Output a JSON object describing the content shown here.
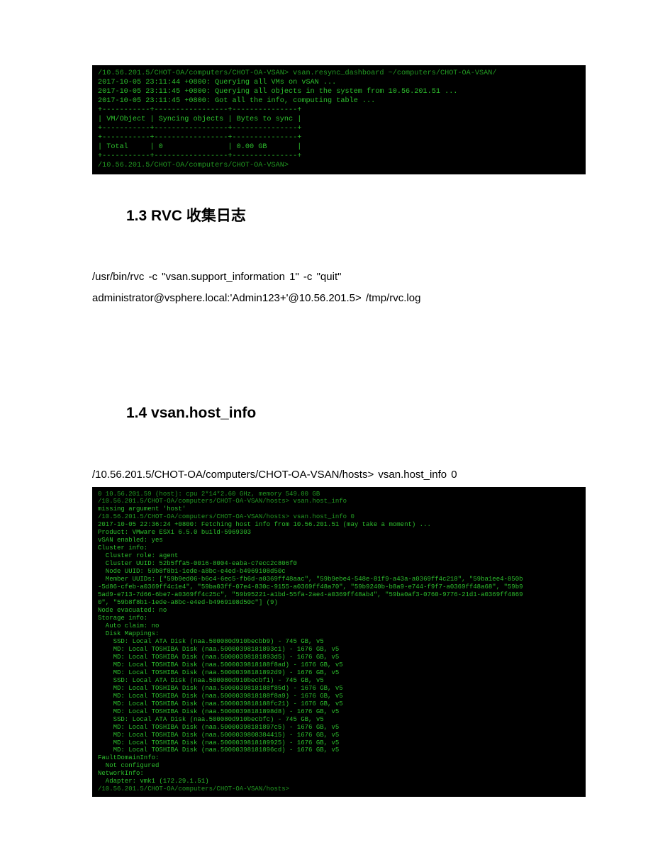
{
  "term1": {
    "l1": "/10.56.201.5/CHOT-OA/computers/CHOT-OA-VSAN> vsan.resync_dashboard ~/computers/CHOT-OA-VSAN/",
    "l2": "2017-10-05 23:11:44 +0800: Querying all VMs on vSAN ...",
    "l3": "2017-10-05 23:11:45 +0800: Querying all objects in the system from 10.56.201.51 ...",
    "l4": "2017-10-05 23:11:45 +0800: Got all the info, computing table ...",
    "sep1": "+-----------+-----------------+---------------+",
    "hdr": "| VM/Object | Syncing objects | Bytes to sync |",
    "sep2": "+-----------+-----------------+---------------+",
    "sep3": "+-----------+-----------------+---------------+",
    "tot": "| Total     | 0               | 0.00 GB       |",
    "sep4": "+-----------+-----------------+---------------+",
    "l5": "/10.56.201.5/CHOT-OA/computers/CHOT-OA-VSAN>"
  },
  "heading13": "1.3 RVC 收集日志",
  "para1_l1": "/usr/bin/rvc  -c  \"vsan.support_information  1\"  -c  \"quit\"",
  "para1_l2": "administrator@vsphere.local:'Admin123+'@10.56.201.5>  /tmp/rvc.log",
  "heading14": "1.4 vsan.host_info",
  "para2_l1": "/10.56.201.5/CHOT-OA/computers/CHOT-OA-VSAN/hosts>  vsan.host_info  0",
  "term2": {
    "l0": "0 10.56.201.59 (host): cpu 2*14*2.60 GHz, memory 549.00 GB",
    "l1": "/10.56.201.5/CHOT-OA/computers/CHOT-OA-VSAN/hosts> vsan.host_info",
    "l2": "missing argument 'host'",
    "l3": "/10.56.201.5/CHOT-OA/computers/CHOT-OA-VSAN/hosts> vsan.host_info 0",
    "l4": "2017-10-05 22:36:24 +0800: Fetching host info from 10.56.201.51 (may take a moment) ...",
    "l5": "Product: VMware ESXi 6.5.0 build-5969303",
    "l6": "vSAN enabled: yes",
    "l7": "Cluster info:",
    "l8": "  Cluster role: agent",
    "l9": "  Cluster UUID: 52b5ffa5-0016-8004-eaba-c7ecc2c806f0",
    "l10": "  Node UUID: 59b8f8b1-1ede-a8bc-e4ed-b4969108d50c",
    "l11": "  Member UUIDs: [\"59b9ed06-b6c4-6ec5-fb6d-a0369ff48aac\", \"59b9ebe4-548e-81f9-a43a-a0369ff4c218\", \"59ba1ee4-850b",
    "l12": "-5d86-cfeb-a0369ff4c1e4\", \"59ba03ff-07e4-830c-9155-a0369ff48a70\", \"59b9240b-b8a9-e744-f9f7-a0369ff48a68\", \"59b9",
    "l13": "5ad9-e713-7d66-6be7-a0369ff4c25c\", \"59b95221-a1bd-55fa-2ae4-a0369ff48ab4\", \"59ba0af3-0760-9776-21d1-a0369ff4869",
    "l14": "0\", \"59b8f8b1-1ede-a8bc-e4ed-b4969108d50c\"] (9)",
    "l15": "Node evacuated: no",
    "l16": "Storage info:",
    "l17": "  Auto claim: no",
    "l18": "  Disk Mappings:",
    "l19": "    SSD: Local ATA Disk (naa.500080d910becbb9) - 745 GB, v5",
    "l20": "    MD: Local TOSHIBA Disk (naa.50000398181893c1) - 1676 GB, v5",
    "l21": "    MD: Local TOSHIBA Disk (naa.50000398181893d5) - 1676 GB, v5",
    "l22": "    MD: Local TOSHIBA Disk (naa.5000039818188f8ad) - 1676 GB, v5",
    "l23": "    MD: Local TOSHIBA Disk (naa.50000398181892d9) - 1676 GB, v5",
    "l24": "    SSD: Local ATA Disk (naa.500080d910becbf1) - 745 GB, v5",
    "l25": "    MD: Local TOSHIBA Disk (naa.5000039818188f85d) - 1676 GB, v5",
    "l26": "    MD: Local TOSHIBA Disk (naa.5000039818188f8a9) - 1676 GB, v5",
    "l27": "    MD: Local TOSHIBA Disk (naa.5000039818188fc21) - 1676 GB, v5",
    "l28": "    MD: Local TOSHIBA Disk (naa.50000398181898d8) - 1676 GB, v5",
    "l29": "    SSD: Local ATA Disk (naa.500080d910becbfc) - 745 GB, v5",
    "l30": "    MD: Local TOSHIBA Disk (naa.50000398181897c5) - 1676 GB, v5",
    "l31": "    MD: Local TOSHIBA Disk (naa.5000039808384415) - 1676 GB, v5",
    "l32": "    MD: Local TOSHIBA Disk (naa.5000039818189925) - 1676 GB, v5",
    "l33": "    MD: Local TOSHIBA Disk (naa.50000398181896cd) - 1676 GB, v5",
    "l34": "FaultDomainInfo:",
    "l35": "  Not configured",
    "l36": "NetworkInfo:",
    "l37": "  Adapter: vmk1 (172.29.1.51)",
    "l38": "/10.56.201.5/CHOT-OA/computers/CHOT-OA-VSAN/hosts>"
  }
}
